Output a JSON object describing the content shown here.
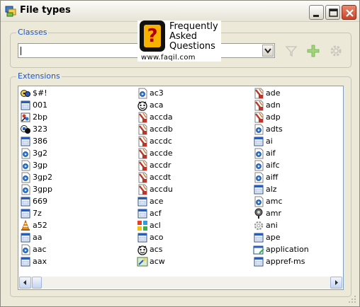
{
  "window": {
    "title": "File types"
  },
  "classes": {
    "group_label": "Classes",
    "value": ""
  },
  "faq_banner": {
    "line1": "Frequently",
    "line2": "Asked",
    "line3": "Questions",
    "url": "www.faqil.com",
    "glyph": "?"
  },
  "extensions": {
    "group_label": "Extensions",
    "columns": [
      [
        {
          "label": "$#!",
          "icon": "special-icon"
        },
        {
          "label": "001",
          "icon": "window-app-icon"
        },
        {
          "label": "2bp",
          "icon": "paint-icon"
        },
        {
          "label": "323",
          "icon": "netmeeting-icon"
        },
        {
          "label": "386",
          "icon": "window-app-icon"
        },
        {
          "label": "3g2",
          "icon": "media-icon"
        },
        {
          "label": "3gp",
          "icon": "media-icon"
        },
        {
          "label": "3gp2",
          "icon": "media-icon"
        },
        {
          "label": "3gpp",
          "icon": "media-icon"
        },
        {
          "label": "669",
          "icon": "window-app-icon"
        },
        {
          "label": "7z",
          "icon": "window-app-icon"
        },
        {
          "label": "a52",
          "icon": "vlc-cone-icon"
        },
        {
          "label": "aa",
          "icon": "window-app-icon"
        },
        {
          "label": "aac",
          "icon": "media-icon"
        },
        {
          "label": "aax",
          "icon": "window-app-icon"
        }
      ],
      [
        {
          "label": "ac3",
          "icon": "media-icon"
        },
        {
          "label": "aca",
          "icon": "agent-icon"
        },
        {
          "label": "accda",
          "icon": "access-icon"
        },
        {
          "label": "accdb",
          "icon": "access-icon"
        },
        {
          "label": "accdc",
          "icon": "access-icon"
        },
        {
          "label": "accde",
          "icon": "access-icon"
        },
        {
          "label": "accdr",
          "icon": "access-icon"
        },
        {
          "label": "accdt",
          "icon": "access-icon"
        },
        {
          "label": "accdu",
          "icon": "access-icon"
        },
        {
          "label": "ace",
          "icon": "window-app-icon"
        },
        {
          "label": "acf",
          "icon": "window-app-icon"
        },
        {
          "label": "acl",
          "icon": "colorful-grid-icon"
        },
        {
          "label": "aco",
          "icon": "window-app-icon"
        },
        {
          "label": "acs",
          "icon": "agent-icon"
        },
        {
          "label": "acw",
          "icon": "wizard-icon"
        }
      ],
      [
        {
          "label": "ade",
          "icon": "access-icon"
        },
        {
          "label": "adn",
          "icon": "access-icon"
        },
        {
          "label": "adp",
          "icon": "access-icon"
        },
        {
          "label": "adts",
          "icon": "media-icon"
        },
        {
          "label": "ai",
          "icon": "window-app-icon"
        },
        {
          "label": "aif",
          "icon": "media-icon"
        },
        {
          "label": "aifc",
          "icon": "media-icon"
        },
        {
          "label": "aiff",
          "icon": "media-icon"
        },
        {
          "label": "alz",
          "icon": "window-app-icon"
        },
        {
          "label": "amc",
          "icon": "media-icon"
        },
        {
          "label": "amr",
          "icon": "pin-icon"
        },
        {
          "label": "ani",
          "icon": "gear-icon"
        },
        {
          "label": "ape",
          "icon": "window-app-icon"
        },
        {
          "label": "application",
          "icon": "application-icon"
        },
        {
          "label": "appref-ms",
          "icon": "window-app-icon"
        }
      ]
    ]
  }
}
